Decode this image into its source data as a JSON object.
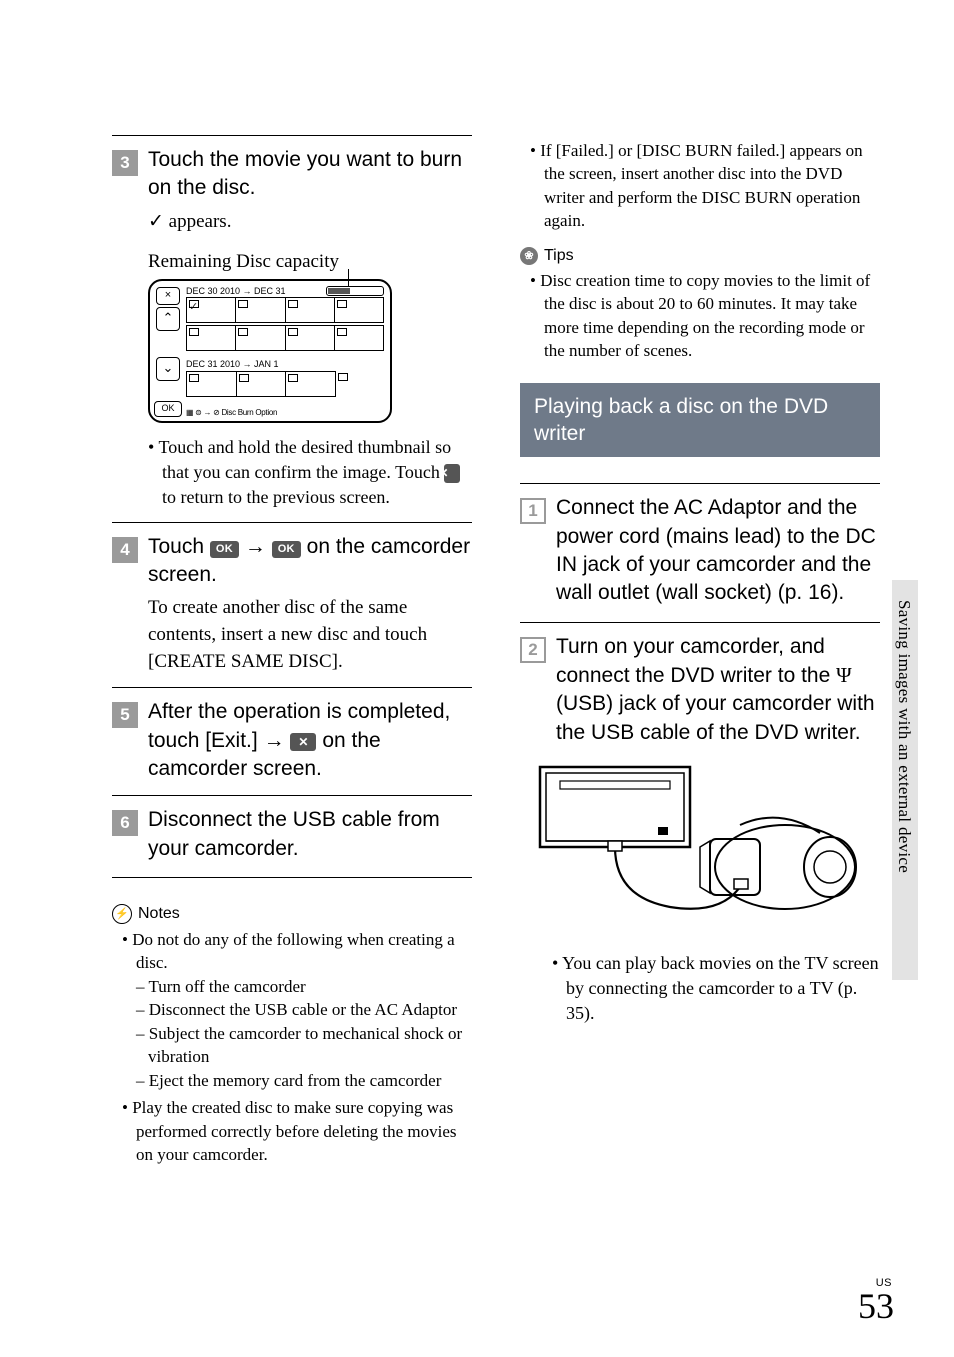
{
  "domain": "Document",
  "page": {
    "number": "53",
    "region": "US"
  },
  "side_tab": "Saving images with an external device",
  "left": {
    "step3": {
      "head": "Touch the movie you want to burn on the disc.",
      "sub_prefix": "✓",
      "sub": "appears.",
      "caption": "Remaining Disc capacity",
      "ss": {
        "close": "×",
        "up": "⌃",
        "down": "⌄",
        "ok": "OK",
        "date1": "DEC 30 2010 → DEC 31",
        "date2": "DEC 31 2010 → JAN 1",
        "bottom": "▦ ⊜ → ⊘ Disc Burn Option",
        "check": "✓"
      },
      "bullet": "Touch and hold the desired thumbnail so that you can confirm the image. Touch",
      "bullet_tail": "to return to the previous screen.",
      "x_label": "✕"
    },
    "step4": {
      "head_pre": "Touch",
      "ok1": "OK",
      "arrow": "→",
      "ok2": "OK",
      "head_post": "on the camcorder screen.",
      "body": "To create another disc of the same contents, insert a new disc and touch [CREATE SAME DISC]."
    },
    "step5": {
      "head_pre": "After the operation is completed, touch [Exit.]",
      "arrow": "→",
      "x_label": "✕",
      "head_post": "on the camcorder screen."
    },
    "step6": {
      "head": "Disconnect the USB cable from your camcorder."
    },
    "notes": {
      "title": "Notes",
      "n1": "Do not do any of the following when creating a disc.",
      "d1": "Turn off the camcorder",
      "d2": "Disconnect the USB cable or the AC Adaptor",
      "d3": "Subject the camcorder to mechanical shock or vibration",
      "d4": "Eject the memory card from the camcorder",
      "n2": "Play the created disc to make sure copying was performed correctly before deleting the movies on your camcorder."
    }
  },
  "right": {
    "top_bullet": "If [Failed.] or [DISC BURN failed.] appears on the screen, insert another disc into the DVD writer and perform the DISC BURN operation again.",
    "tips": {
      "title": "Tips",
      "t1": "Disc creation time to copy movies to the limit of the disc is about 20 to 60 minutes. It may take more time depending on the recording mode or the number of scenes."
    },
    "section": "Playing back a disc on the DVD writer",
    "step1": "Connect the AC Adaptor and the power cord  (mains lead) to the DC IN jack of your camcorder and the wall outlet (wall socket) (p. 16).",
    "step2_pre": "Turn on your camcorder, and connect the DVD writer to the ",
    "step2_psi": "Ψ",
    "step2_post": " (USB) jack of your camcorder with the USB cable of the DVD writer.",
    "fig_bullet": "You can play back movies on the TV screen by connecting the camcorder to a TV (p. 35)."
  }
}
